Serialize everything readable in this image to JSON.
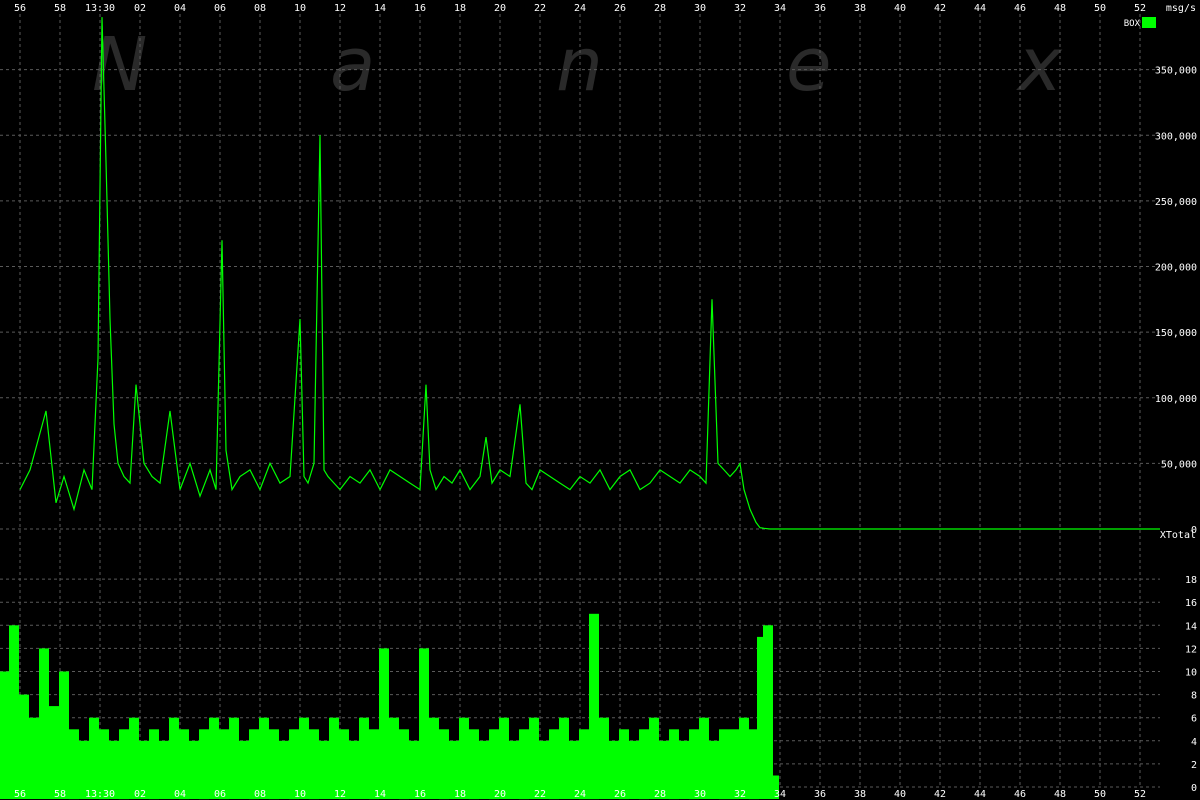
{
  "watermark": [
    "N",
    "a",
    "n",
    "e",
    "x"
  ],
  "x_ticks": [
    "56",
    "58",
    "13:30",
    "02",
    "04",
    "06",
    "08",
    "10",
    "12",
    "14",
    "16",
    "18",
    "20",
    "22",
    "24",
    "26",
    "28",
    "30",
    "32",
    "34",
    "36",
    "38",
    "40",
    "42",
    "44",
    "46",
    "48",
    "50",
    "52"
  ],
  "colors": {
    "series": "#00ff00",
    "grid": "#5a5a5a",
    "text": "#ffffff",
    "background": "#000000"
  },
  "chart_data": [
    {
      "type": "line",
      "panel": "upper",
      "ylabel": "msg/s",
      "ylim": [
        0,
        400000
      ],
      "y_ticks": [
        0,
        50000,
        100000,
        150000,
        200000,
        250000,
        300000,
        350000
      ],
      "y_tick_labels": [
        "0",
        "50,000",
        "100,000",
        "150,000",
        "200,000",
        "250,000",
        "300,000",
        "350,000"
      ],
      "xlim": [
        -5,
        53
      ],
      "legend": "top-right",
      "series": [
        {
          "name": "BOX",
          "x": [
            -4,
            -3.5,
            -2.7,
            -2.2,
            -1.8,
            -1.3,
            -0.8,
            -0.4,
            -0.1,
            0.1,
            0.3,
            0.5,
            0.7,
            0.9,
            1.2,
            1.5,
            1.8,
            2.2,
            2.6,
            3.0,
            3.5,
            4.0,
            4.5,
            5.0,
            5.5,
            5.8,
            6.1,
            6.3,
            6.6,
            7.0,
            7.5,
            8.0,
            8.5,
            9.0,
            9.5,
            10.0,
            10.2,
            10.4,
            10.7,
            11.0,
            11.2,
            11.4,
            11.7,
            12.0,
            12.5,
            13.0,
            13.5,
            14.0,
            14.5,
            15.0,
            15.5,
            16.0,
            16.3,
            16.5,
            16.8,
            17.2,
            17.6,
            18.0,
            18.5,
            19.0,
            19.3,
            19.6,
            20.0,
            20.5,
            21.0,
            21.3,
            21.6,
            22.0,
            22.5,
            23.0,
            23.5,
            24.0,
            24.5,
            25.0,
            25.5,
            26.0,
            26.5,
            27.0,
            27.5,
            28.0,
            28.5,
            29.0,
            29.5,
            30.0,
            30.3,
            30.6,
            30.9,
            31.2,
            31.5,
            31.8,
            32.0,
            32.2,
            32.5,
            32.8,
            33.0,
            33.2,
            33.5,
            34.0,
            53.0
          ],
          "y": [
            30000,
            45000,
            90000,
            20000,
            40000,
            15000,
            45000,
            30000,
            130000,
            390000,
            280000,
            160000,
            80000,
            50000,
            40000,
            35000,
            110000,
            50000,
            40000,
            35000,
            90000,
            30000,
            50000,
            25000,
            45000,
            30000,
            220000,
            60000,
            30000,
            40000,
            45000,
            30000,
            50000,
            35000,
            40000,
            160000,
            40000,
            35000,
            50000,
            300000,
            45000,
            40000,
            35000,
            30000,
            40000,
            35000,
            45000,
            30000,
            45000,
            40000,
            35000,
            30000,
            110000,
            45000,
            30000,
            40000,
            35000,
            45000,
            30000,
            40000,
            70000,
            35000,
            45000,
            40000,
            95000,
            35000,
            30000,
            45000,
            40000,
            35000,
            30000,
            40000,
            35000,
            45000,
            30000,
            40000,
            45000,
            30000,
            35000,
            45000,
            40000,
            35000,
            45000,
            40000,
            35000,
            175000,
            50000,
            45000,
            40000,
            45000,
            50000,
            30000,
            15000,
            5000,
            1000,
            500,
            0,
            0,
            0
          ]
        }
      ]
    },
    {
      "type": "bar",
      "panel": "lower",
      "ylabel": "XTotal",
      "ylim": [
        0,
        20
      ],
      "y_ticks": [
        0,
        2,
        4,
        6,
        8,
        10,
        12,
        14,
        16,
        18
      ],
      "y_tick_labels": [
        "0",
        "2",
        "4",
        "6",
        "8",
        "10",
        "12",
        "14",
        "16",
        "18"
      ],
      "xlim": [
        -5,
        53
      ],
      "series": [
        {
          "name": "XTotal",
          "x": [
            -4.8,
            -4.3,
            -3.8,
            -3.3,
            -2.8,
            -2.3,
            -1.8,
            -1.3,
            -0.8,
            -0.3,
            0.2,
            0.7,
            1.2,
            1.7,
            2.2,
            2.7,
            3.2,
            3.7,
            4.2,
            4.7,
            5.2,
            5.7,
            6.2,
            6.7,
            7.2,
            7.7,
            8.2,
            8.7,
            9.2,
            9.7,
            10.2,
            10.7,
            11.2,
            11.7,
            12.2,
            12.7,
            13.2,
            13.7,
            14.2,
            14.7,
            15.2,
            15.7,
            16.2,
            16.7,
            17.2,
            17.7,
            18.2,
            18.7,
            19.2,
            19.7,
            20.2,
            20.7,
            21.2,
            21.7,
            22.2,
            22.7,
            23.2,
            23.7,
            24.2,
            24.7,
            25.2,
            25.7,
            26.2,
            26.7,
            27.2,
            27.7,
            28.2,
            28.7,
            29.2,
            29.7,
            30.2,
            30.7,
            31.2,
            31.7,
            32.2,
            32.7,
            33.1,
            33.4,
            33.7
          ],
          "y": [
            10,
            14,
            8,
            6,
            12,
            7,
            10,
            5,
            4,
            6,
            5,
            4,
            5,
            6,
            4,
            5,
            4,
            6,
            5,
            4,
            5,
            6,
            5,
            6,
            4,
            5,
            6,
            5,
            4,
            5,
            6,
            5,
            4,
            6,
            5,
            4,
            6,
            5,
            12,
            6,
            5,
            4,
            12,
            6,
            5,
            4,
            6,
            5,
            4,
            5,
            6,
            4,
            5,
            6,
            4,
            5,
            6,
            4,
            5,
            15,
            6,
            4,
            5,
            4,
            5,
            6,
            4,
            5,
            4,
            5,
            6,
            4,
            5,
            5,
            6,
            5,
            13,
            14,
            1
          ]
        }
      ]
    }
  ]
}
